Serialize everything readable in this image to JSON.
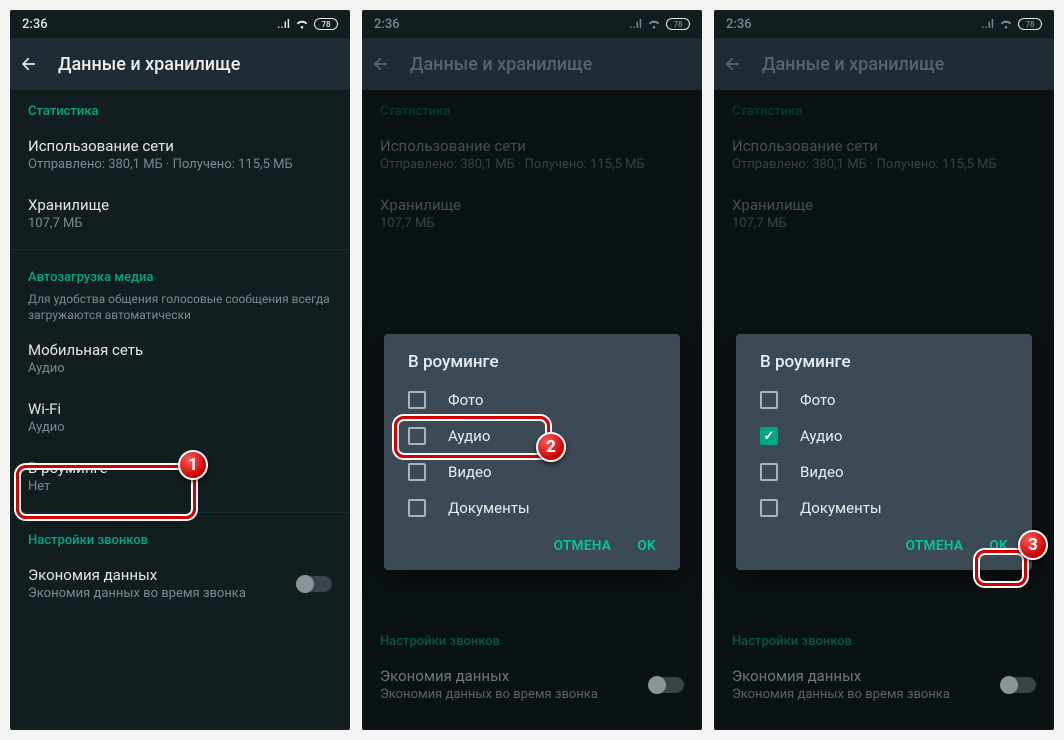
{
  "status": {
    "time": "2:36",
    "battery": "78"
  },
  "screen_title": "Данные и хранилище",
  "sections": {
    "stats": {
      "header": "Статистика",
      "network": {
        "title": "Использование сети",
        "sub": "Отправлено: 380,1 МБ · Получено: 115,5 МБ"
      },
      "storage": {
        "title": "Хранилище",
        "sub": "107,7 МБ"
      }
    },
    "autoload": {
      "header": "Автозагрузка медиа",
      "desc": "Для удобства общения голосовые сообщения всегда загружаются автоматически",
      "mobile": {
        "title": "Мобильная сеть",
        "sub": "Аудио"
      },
      "wifi": {
        "title": "Wi-Fi",
        "sub": "Аудио"
      },
      "roaming": {
        "title": "В роуминге",
        "sub": "Нет"
      }
    },
    "calls": {
      "header": "Настройки звонков",
      "economy": {
        "title": "Экономия данных",
        "sub": "Экономия данных во время звонка"
      }
    }
  },
  "dialog": {
    "title": "В роуминге",
    "options": {
      "photo": "Фото",
      "audio": "Аудио",
      "video": "Видео",
      "docs": "Документы"
    },
    "cancel": "ОТМЕНА",
    "ok": "OK"
  },
  "meta": {
    "screens": 3,
    "annotations": [
      {
        "n": 1,
        "target": "roaming-row"
      },
      {
        "n": 2,
        "target": "dialog-audio-row"
      },
      {
        "n": 3,
        "target": "dialog-ok-button"
      }
    ],
    "dialog_checked_screen3": "audio"
  }
}
